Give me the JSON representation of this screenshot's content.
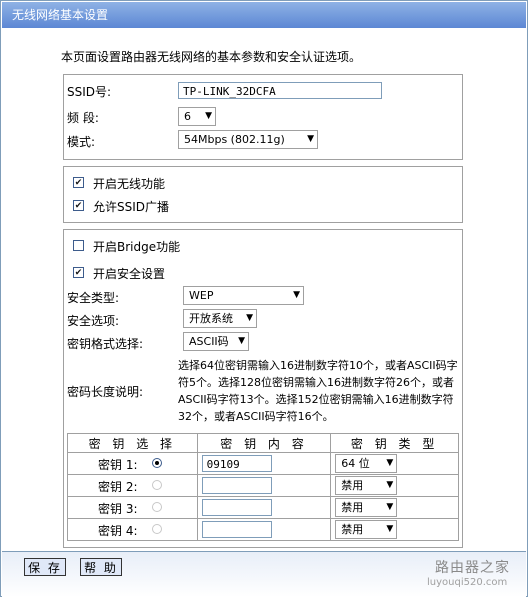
{
  "title": "无线网络基本设置",
  "intro": "本页面设置路由器无线网络的基本参数和安全认证选项。",
  "basic": {
    "ssid_label": "SSID号:",
    "ssid_value": "TP-LINK_32DCFA",
    "channel_label": "频 段:",
    "channel_value": "6",
    "mode_label": "模式:",
    "mode_value": "54Mbps (802.11g)"
  },
  "wireless": {
    "enable_label": "开启无线功能",
    "enable_checked": true,
    "ssid_broadcast_label": "允许SSID广播",
    "ssid_broadcast_checked": true
  },
  "security": {
    "bridge_label": "开启Bridge功能",
    "bridge_checked": false,
    "enable_security_label": "开启安全设置",
    "enable_security_checked": true,
    "type_label": "安全类型:",
    "type_value": "WEP",
    "option_label": "安全选项:",
    "option_value": "开放系统",
    "format_label": "密钥格式选择:",
    "format_value": "ASCII码",
    "length_label": "密码长度说明:",
    "length_desc": "选择64位密钥需输入16进制数字符10个，或者ASCII码字符5个。选择128位密钥需输入16进制数字符26个，或者ASCII码字符13个。选择152位密钥需输入16进制数字符32个，或者ASCII码字符16个。"
  },
  "keys": {
    "headers": [
      "密 钥 选 择",
      "密 钥 内 容",
      "密 钥 类 型"
    ],
    "rows": [
      {
        "label": "密钥 1:",
        "selected": true,
        "value": "09109",
        "type": "64 位"
      },
      {
        "label": "密钥 2:",
        "selected": false,
        "value": "",
        "type": "禁用"
      },
      {
        "label": "密钥 3:",
        "selected": false,
        "value": "",
        "type": "禁用"
      },
      {
        "label": "密钥 4:",
        "selected": false,
        "value": "",
        "type": "禁用"
      }
    ]
  },
  "buttons": {
    "save": "保 存",
    "help": "帮 助"
  },
  "watermark": {
    "name": "路由器之家",
    "url": "luyouqi520.com"
  }
}
